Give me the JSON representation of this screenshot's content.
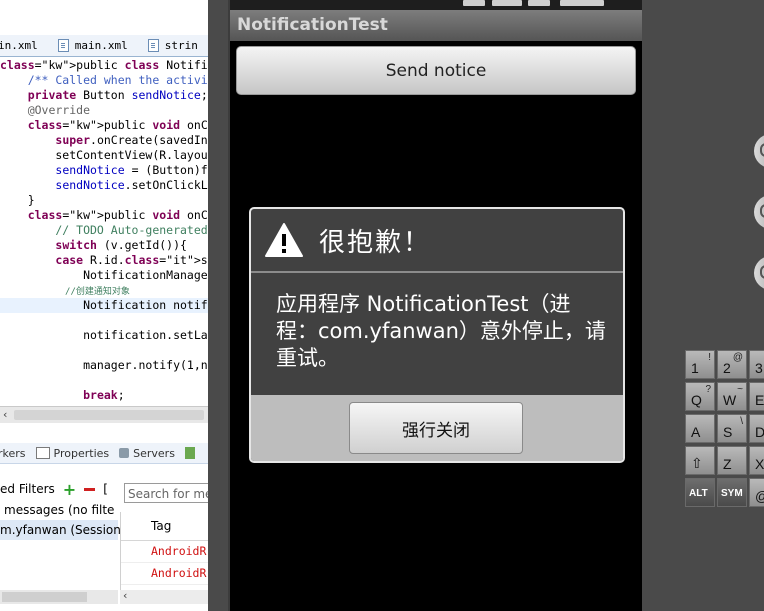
{
  "ide": {
    "tabs": [
      {
        "label": "in.xml"
      },
      {
        "label": "main.xml"
      },
      {
        "label": "strin"
      }
    ],
    "code_lines": [
      "public class NotificationTestA",
      "    /** Called when the activi",
      "    private Button sendNotice;",
      "    @Override",
      "    public void onCreate(Bundl",
      "        super.onCreate(savedIn",
      "        setContentView(R.layou",
      "        sendNotice = (Button)f",
      "        sendNotice.setOnClickL",
      "    }",
      "    public void onClick(View v",
      "        // TODO Auto-generated",
      "        switch (v.getId()){",
      "        case R.id.send_notice:",
      "            NotificationManage",
      "            //创建通知对象",
      "            Notification notif",
      "",
      "            notification.setLa",
      "",
      "            manager.notify(1,n",
      "",
      "            break;"
    ],
    "views": {
      "markers": "rkers",
      "properties": "Properties",
      "servers": "Servers"
    },
    "filters": {
      "title": "ed Filters",
      "bracket": "[",
      "rows": [
        {
          "label": "messages (no filte"
        },
        {
          "label": "m.yfanwan (Session"
        }
      ]
    },
    "search": {
      "placeholder": "Search for me"
    },
    "log": {
      "header": "Tag",
      "rows": [
        "AndroidR",
        "AndroidR"
      ]
    }
  },
  "emulator": {
    "app_title": "NotificationTest",
    "send_button": "Send notice",
    "dialog": {
      "title": "很抱歉！",
      "message": "应用程序 NotificationTest（进程：com.yfanwan）意外停止，请重试。",
      "force_close": "强行关闭"
    },
    "keyboard": [
      {
        "main": "1",
        "alt": "!"
      },
      {
        "main": "2",
        "alt": "@"
      },
      {
        "main": "3",
        "alt": ""
      },
      {
        "main": "Q",
        "alt": "?"
      },
      {
        "main": "W",
        "alt": "~"
      },
      {
        "main": "E",
        "alt": ""
      },
      {
        "main": "A",
        "alt": ""
      },
      {
        "main": "S",
        "alt": "\\"
      },
      {
        "main": "D",
        "alt": ""
      },
      {
        "main": "⇧",
        "alt": ""
      },
      {
        "main": "Z",
        "alt": ""
      },
      {
        "main": "X",
        "alt": ""
      },
      {
        "main": "ALT",
        "alt": ""
      },
      {
        "main": "SYM",
        "alt": ""
      },
      {
        "main": "@",
        "alt": ""
      }
    ]
  },
  "colors": {
    "dialog_bg": "#414141",
    "dialog_footer": "#bdbdbd",
    "keyword": "#7f0055",
    "log_error": "#d01010"
  }
}
